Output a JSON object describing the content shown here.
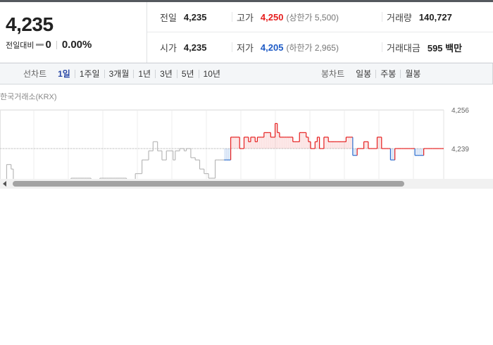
{
  "summary": {
    "price": "4,235",
    "change_label": "전일대비",
    "change_value": "0",
    "change_pct": "0.00%",
    "stats": {
      "prev_close": {
        "label": "전일",
        "value": "4,235"
      },
      "high": {
        "label": "고가",
        "value": "4,250",
        "sub": "(상한가 5,500)"
      },
      "volume": {
        "label": "거래량",
        "value": "140,727"
      },
      "open": {
        "label": "시가",
        "value": "4,235"
      },
      "low": {
        "label": "저가",
        "value": "4,205",
        "sub": "(하한가 2,965)"
      },
      "amount": {
        "label": "거래대금",
        "value": "595 백만"
      }
    }
  },
  "tabs": {
    "line_label": "선차트",
    "line_tabs": [
      "1일",
      "1주일",
      "3개월",
      "1년",
      "3년",
      "5년",
      "10년"
    ],
    "active_line_tab": "1일",
    "candle_label": "봉차트",
    "candle_tabs": [
      "일봉",
      "주봉",
      "월봉"
    ]
  },
  "chart": {
    "source": "한국거래소(KRX)",
    "ref_price_label": "4,239",
    "top_label": "4,256",
    "colors": {
      "up": "#e61e1e",
      "down": "#2f6fcf",
      "flat": "#b8b8b8"
    }
  },
  "chart_data": {
    "type": "line",
    "title": "",
    "ylabel": "",
    "ylim": [
      4222,
      4256
    ],
    "yticks": [
      4256,
      4239
    ],
    "reference": 4239,
    "series": [
      {
        "values": [
          4222,
          4222,
          4222,
          4232,
          4232,
          4230,
          4222,
          4222,
          4220,
          4222,
          4222,
          4222,
          4222,
          4222,
          4222,
          4222,
          4222,
          4222,
          4222,
          4222,
          4222,
          4222,
          4224,
          4224,
          4224,
          4224,
          4224,
          4224,
          4222,
          4222,
          4222,
          4222,
          4226,
          4226,
          4226,
          4226,
          4226,
          4226,
          4226,
          4226,
          4226,
          4224,
          4224,
          4224,
          4224,
          4226,
          4226,
          4226,
          4226,
          4226,
          4226,
          4226,
          4226,
          4226,
          4226,
          4226,
          4226,
          4224,
          4224,
          4224,
          4224,
          4228,
          4228,
          4228,
          4234,
          4234,
          4234,
          4238,
          4238,
          4242,
          4242,
          4238,
          4238,
          4234,
          4234,
          4238,
          4238,
          4238,
          4234,
          4238,
          4238,
          4239,
          4239,
          4238,
          4239,
          4239,
          4235,
          4235,
          4234,
          4234,
          4230,
          4230,
          4228,
          4228,
          4226,
          4226,
          4226,
          4234,
          4234,
          4234,
          4234,
          4234,
          4234,
          4234,
          4244,
          4244,
          4244,
          4244,
          4239,
          4239,
          4244,
          4244,
          4242,
          4244,
          4244,
          4242,
          4244,
          4244,
          4244,
          4246,
          4246,
          4246,
          4244,
          4244,
          4250,
          4246,
          4244,
          4244,
          4244,
          4244,
          4244,
          4244,
          4242,
          4242,
          4242,
          4246,
          4246,
          4246,
          4244,
          4242,
          4239,
          4239,
          4242,
          4244,
          4239,
          4239,
          4244,
          4244,
          4242,
          4242,
          4242,
          4242,
          4242,
          4242,
          4242,
          4242,
          4244,
          4244,
          4244,
          4236,
          4236,
          4239,
          4239,
          4239,
          4242,
          4242,
          4239,
          4239,
          4239,
          4239,
          4244,
          4244,
          4239,
          4239,
          4239,
          4239,
          4234,
          4234,
          4239,
          4239,
          4239,
          4239,
          4239,
          4239,
          4239,
          4239,
          4239,
          4236,
          4236,
          4236,
          4236,
          4239,
          4239,
          4239,
          4239,
          4239,
          4239,
          4239,
          4239,
          4239,
          4239
        ]
      }
    ]
  }
}
